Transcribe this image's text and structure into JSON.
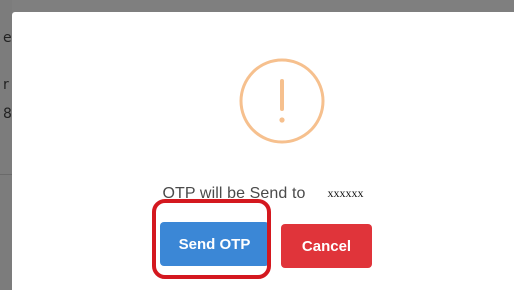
{
  "background": {
    "partial_letters": [
      "e",
      "r",
      "8"
    ]
  },
  "dialog": {
    "icon": "exclamation-circle-icon",
    "icon_color": "#f6c08e",
    "message": "OTP will be Send to",
    "recipient": "xxxxxx",
    "buttons": {
      "send_label": "Send OTP",
      "cancel_label": "Cancel"
    },
    "colors": {
      "send": "#3b87d6",
      "cancel": "#e0343a",
      "highlight": "#d4181f"
    }
  }
}
